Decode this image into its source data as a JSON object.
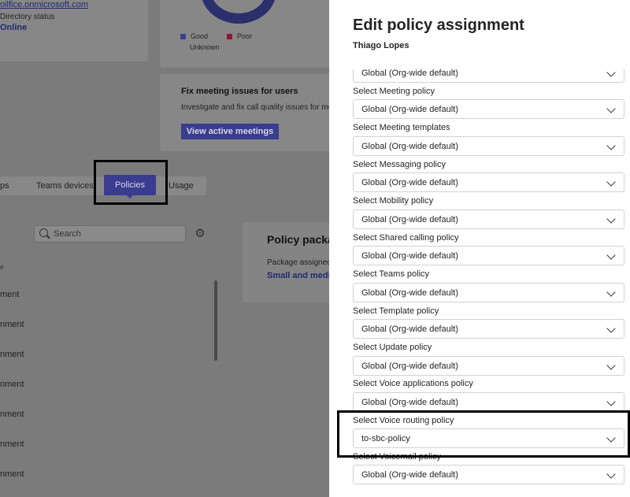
{
  "background": {
    "user_card": {
      "email": "oilfice.onmicrosoft.com",
      "directory_status_label": "Directory status",
      "directory_status_value": "Online"
    },
    "quality_legend": [
      {
        "label": "Good",
        "color": "#3f3f8f"
      },
      {
        "label": "Poor",
        "color": "#8a1b2e"
      },
      {
        "label": "Unknown",
        "color": ""
      }
    ],
    "fix_card": {
      "title": "Fix meeting issues for users",
      "description": "Investigate and fix call quality issues for meeti",
      "button": "View active meetings"
    },
    "tabs": [
      {
        "label": "ps"
      },
      {
        "label": "Teams devices"
      },
      {
        "label": "Policies"
      },
      {
        "label": "Usage"
      }
    ],
    "search": {
      "placeholder": "Search"
    },
    "list_header": "e",
    "list_items": [
      "ment",
      "nment",
      "nment",
      "nment",
      "nment",
      "nment",
      "nment"
    ],
    "package_card": {
      "title": "Policy packa",
      "label": "Package assigned",
      "value": "Small and medi"
    }
  },
  "panel": {
    "title": "Edit policy assignment",
    "user": "Thiago Lopes",
    "top_dropdown": "Global (Org-wide default)",
    "policies": [
      {
        "label": "Select Meeting policy",
        "value": "Global (Org-wide default)"
      },
      {
        "label": "Select Meeting templates",
        "value": "Global (Org-wide default)"
      },
      {
        "label": "Select Messaging policy",
        "value": "Global (Org-wide default)"
      },
      {
        "label": "Select Mobility policy",
        "value": "Global (Org-wide default)"
      },
      {
        "label": "Select Shared calling policy",
        "value": "Global (Org-wide default)"
      },
      {
        "label": "Select Teams policy",
        "value": "Global (Org-wide default)"
      },
      {
        "label": "Select Template policy",
        "value": "Global (Org-wide default)"
      },
      {
        "label": "Select Update policy",
        "value": "Global (Org-wide default)"
      },
      {
        "label": "Select Voice applications policy",
        "value": "Global (Org-wide default)"
      },
      {
        "label": "Select Voice routing policy",
        "value": "to-sbc-policy"
      },
      {
        "label": "Select Voicemail policy",
        "value": "Global (Org-wide default)"
      }
    ]
  }
}
